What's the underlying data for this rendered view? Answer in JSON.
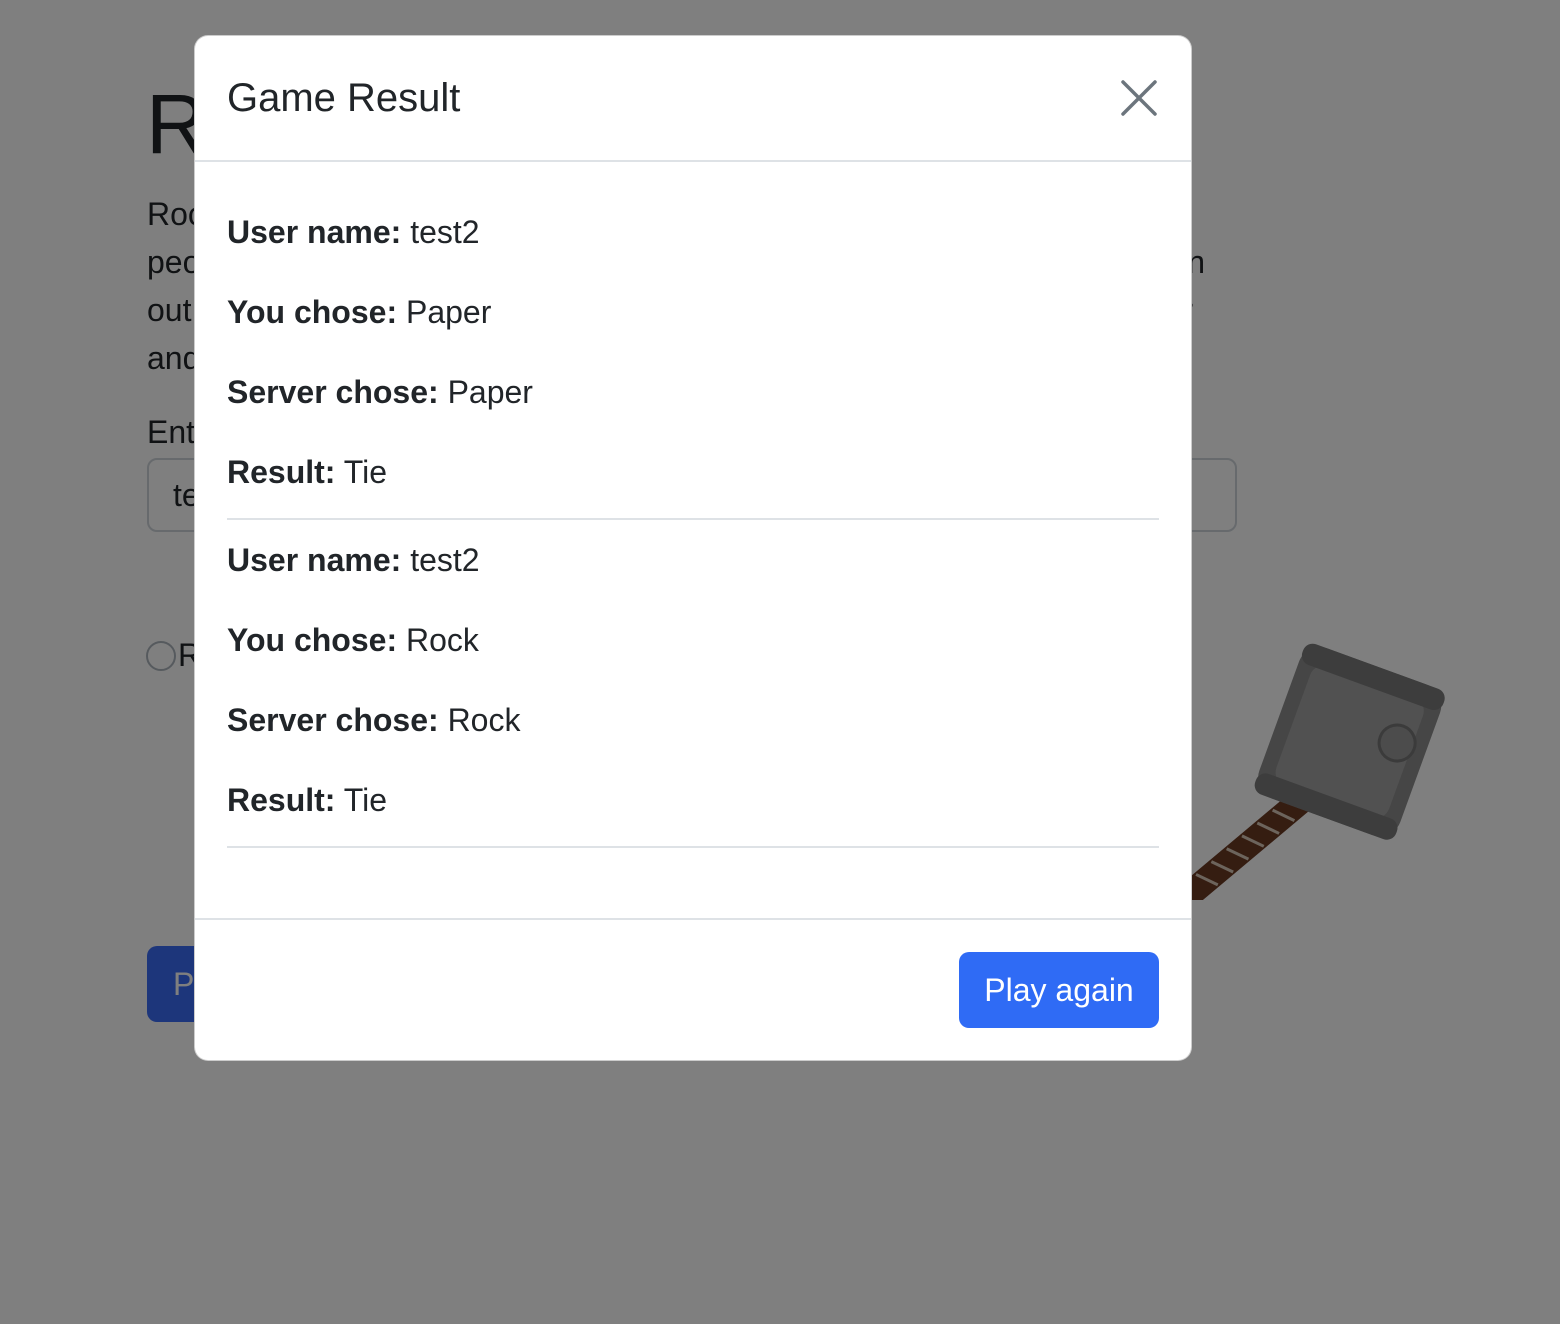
{
  "background": {
    "title": "R",
    "paragraph_lines": [
      "Roc",
      "peo",
      "out",
      "and"
    ],
    "paragraph_right_fragments": [
      "n",
      "r"
    ],
    "input_label": "Ent",
    "input_value": "te",
    "choice_label": "R",
    "play_button_label": "P"
  },
  "modal": {
    "title": "Game Result",
    "results": [
      {
        "user_name_label": "User name:",
        "user_name": "test2",
        "you_chose_label": "You chose:",
        "you_chose": "Paper",
        "server_chose_label": "Server chose:",
        "server_chose": "Paper",
        "result_label": "Result:",
        "result": "Tie"
      },
      {
        "user_name_label": "User name:",
        "user_name": "test2",
        "you_chose_label": "You chose:",
        "you_chose": "Rock",
        "server_chose_label": "Server chose:",
        "server_chose": "Rock",
        "result_label": "Result:",
        "result": "Tie"
      }
    ],
    "play_again_label": "Play again"
  },
  "icons": {
    "close": "close-icon",
    "hammer": "hammer-image"
  },
  "colors": {
    "primary": "#2f6bf5",
    "backdrop": "rgba(0,0,0,0.5)"
  }
}
